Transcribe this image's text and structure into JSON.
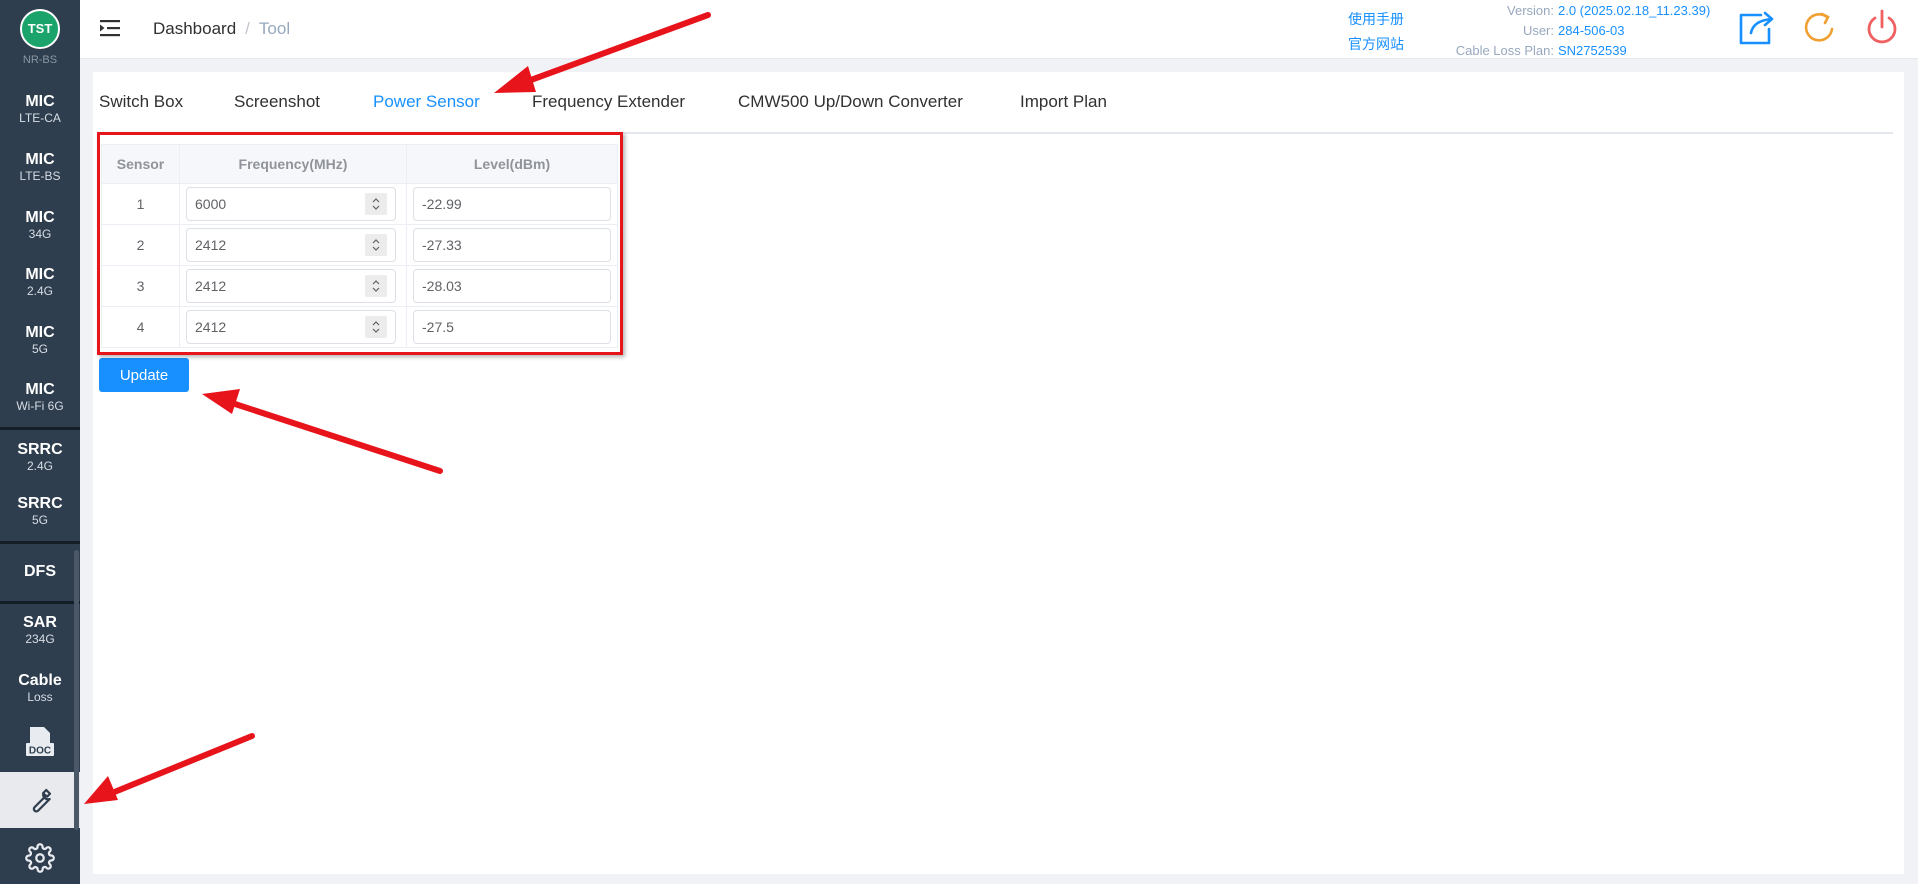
{
  "sidebar": {
    "logo_text": "TST",
    "cut_label": "NR-BS",
    "items": [
      {
        "title": "MIC",
        "sub": "LTE-CA"
      },
      {
        "title": "MIC",
        "sub": "LTE-BS"
      },
      {
        "title": "MIC",
        "sub": "34G"
      },
      {
        "title": "MIC",
        "sub": "2.4G"
      },
      {
        "title": "MIC",
        "sub": "5G"
      },
      {
        "title": "MIC",
        "sub": "Wi-Fi 6G"
      },
      {
        "title": "SRRC",
        "sub": "2.4G"
      },
      {
        "title": "SRRC",
        "sub": "5G"
      },
      {
        "title": "DFS",
        "sub": ""
      },
      {
        "title": "SAR",
        "sub": "234G"
      },
      {
        "title": "Cable",
        "sub": "Loss"
      }
    ],
    "doc_label": "DOC"
  },
  "header": {
    "breadcrumb_home": "Dashboard",
    "breadcrumb_sep": "/",
    "breadcrumb_current": "Tool",
    "link_manual": "使用手册",
    "link_website": "官方网站",
    "version_label": "Version:",
    "version_value": "2.0 (2025.02.18_11.23.39)",
    "user_label": "User:",
    "user_value": "284-506-03",
    "plan_label": "Cable Loss Plan:",
    "plan_value": "SN2752539"
  },
  "tabs": [
    "Switch Box",
    "Screenshot",
    "Power Sensor",
    "Frequency Extender",
    "CMW500 Up/Down Converter",
    "Import Plan"
  ],
  "active_tab": "Power Sensor",
  "table": {
    "headers": [
      "Sensor",
      "Frequency(MHz)",
      "Level(dBm)"
    ],
    "rows": [
      {
        "sensor": "1",
        "frequency": "6000",
        "level": "-22.99"
      },
      {
        "sensor": "2",
        "frequency": "2412",
        "level": "-27.33"
      },
      {
        "sensor": "3",
        "frequency": "2412",
        "level": "-28.03"
      },
      {
        "sensor": "4",
        "frequency": "2412",
        "level": "-27.5"
      }
    ]
  },
  "update_label": "Update",
  "colors": {
    "accent": "#1890ff",
    "sidebar": "#2f3e4e",
    "annotation": "#e8141b",
    "refresh": "#f0a030",
    "power": "#f06060"
  }
}
